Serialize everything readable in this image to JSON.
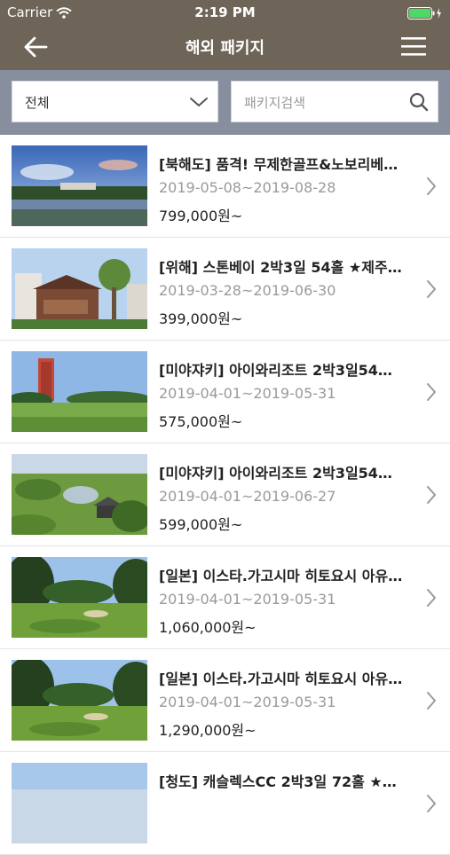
{
  "status_bar": {
    "carrier": "Carrier",
    "time": "2:19 PM"
  },
  "nav": {
    "title": "해외 패키지"
  },
  "filters": {
    "region_select": "전체",
    "search_placeholder": "패키지검색"
  },
  "packages": [
    {
      "title": "[북해도] 품격! 무제한골프&노보리베…",
      "dates": "2019-05-08~2019-08-28",
      "price": "799,000원~"
    },
    {
      "title": "[위해] 스톤베이 2박3일 54홀 ★제주…",
      "dates": "2019-03-28~2019-06-30",
      "price": "399,000원~"
    },
    {
      "title": "[미야쟈키] 아이와리조트 2박3일54…",
      "dates": "2019-04-01~2019-05-31",
      "price": "575,000원~"
    },
    {
      "title": "[미야쟈키] 아이와리조트 2박3일54…",
      "dates": "2019-04-01~2019-06-27",
      "price": "599,000원~"
    },
    {
      "title": "[일본] 이스타.가고시마 히토요시 아유…",
      "dates": "2019-04-01~2019-05-31",
      "price": "1,060,000원~"
    },
    {
      "title": "[일본] 이스타.가고시마 히토요시 아유…",
      "dates": "2019-04-01~2019-05-31",
      "price": "1,290,000원~"
    },
    {
      "title": "[청도] 캐슬렉스CC 2박3일 72홀 ★…",
      "dates": "",
      "price": ""
    }
  ],
  "colors": {
    "header": "#6e6558",
    "filter_bar": "#878e9e",
    "battery": "#4cd964"
  },
  "icons": [
    "back-arrow-icon",
    "menu-icon",
    "chevron-down-icon",
    "search-icon",
    "chevron-right-icon",
    "wifi-icon",
    "battery-icon",
    "charging-icon"
  ]
}
